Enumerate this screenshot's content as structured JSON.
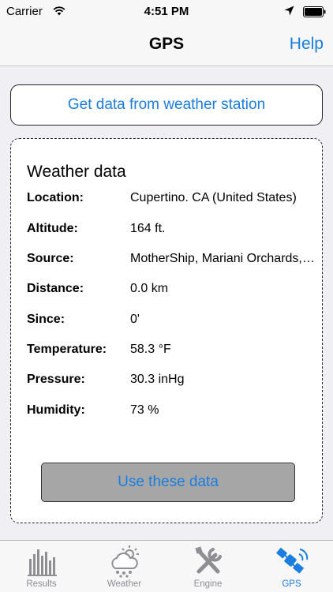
{
  "status_bar": {
    "carrier": "Carrier",
    "time": "4:51 PM"
  },
  "nav": {
    "title": "GPS",
    "help_label": "Help"
  },
  "station_button": {
    "label": "Get data from weather station"
  },
  "weather": {
    "title": "Weather data",
    "rows": [
      {
        "label": "Location:",
        "value": "Cupertino. CA (United States)"
      },
      {
        "label": "Altitude:",
        "value": "164 ft."
      },
      {
        "label": "Source:",
        "value": "MotherShip, Mariani Orchards, Cupertino"
      },
      {
        "label": "Distance:",
        "value": "0.0 km"
      },
      {
        "label": "Since:",
        "value": "0'"
      },
      {
        "label": "Temperature:",
        "value": "58.3 °F"
      },
      {
        "label": "Pressure:",
        "value": "30.3 inHg"
      },
      {
        "label": "Humidity:",
        "value": "73 %"
      }
    ],
    "use_button_label": "Use these data"
  },
  "tabs": [
    {
      "label": "Results",
      "icon": "bar-chart-icon",
      "active": false
    },
    {
      "label": "Weather",
      "icon": "weather-icon",
      "active": false
    },
    {
      "label": "Engine",
      "icon": "tools-icon",
      "active": false
    },
    {
      "label": "GPS",
      "icon": "satellite-icon",
      "active": true
    }
  ],
  "colors": {
    "accent": "#1a7ee0",
    "background": "#efeff4",
    "use_button_bg": "#a6a6a6"
  }
}
